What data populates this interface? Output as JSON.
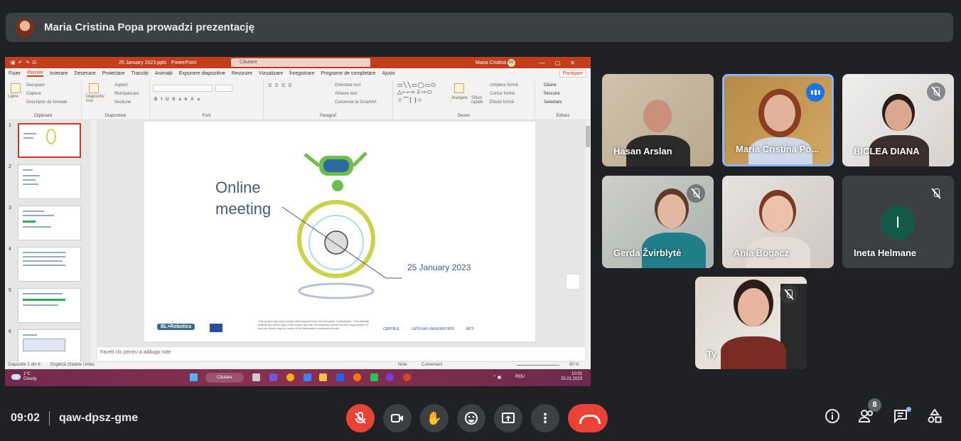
{
  "banner": {
    "presenter_text": "Maria Cristina Popa prowadzi prezentację"
  },
  "ppt": {
    "file_name": "25 January 2023.pptx  ·  PowerPoint",
    "search_placeholder": "Căutare",
    "user_name": "Maria Cristina",
    "user_initials": "MC",
    "share_label": "Partajare",
    "menu": [
      "Fișier",
      "Pornire",
      "Inserare",
      "Desenare",
      "Proiectare",
      "Tranziții",
      "Animații",
      "Expunere diapozitive",
      "Revizuire",
      "Vizualizare",
      "Înregistrare",
      "Programe de completare",
      "Ajutor"
    ],
    "ribbon": {
      "clipboard": {
        "paste": "Lipire",
        "cut": "Decupare",
        "copy": "Copiere",
        "painter": "Descriptor de formate",
        "label": "Clipboard"
      },
      "slides": {
        "new": "Diapozitiv nou",
        "layout": "Aspect",
        "reset": "Reinițializare",
        "section": "Secțiune",
        "label": "Diapozitive"
      },
      "font": {
        "label": "Font"
      },
      "paragraph": {
        "direction": "Orientare text",
        "align": "Aliniere text",
        "smartart": "Conversie la SmartArt",
        "label": "Paragraf"
      },
      "drawing": {
        "arrange": "Aranjare",
        "styles": "Stiluri rapide",
        "fill": "Umplere formă",
        "outline": "Contur formă",
        "effects": "Efecte formă",
        "label": "Desen"
      },
      "editing": {
        "find": "Găsire",
        "replace": "Înlocuire",
        "select": "Selectare",
        "label": "Editare"
      }
    },
    "slide_numbers": [
      "1",
      "2",
      "3",
      "4",
      "5",
      "6"
    ],
    "slide": {
      "title": "Online meeting",
      "date": "25 January 2023",
      "robotics_label": "BL+Robotics",
      "funded_text": "Funded by the Erasmus+ Programme of the European Union",
      "disclaimer": "This project has been funded with support from the European Commission. This website reflects the views only of the author and the Commission cannot be held responsible for any use which may be made of the information contained therein.",
      "logos": [
        "CENTRUL",
        "",
        "",
        "LATVIJAS UNIVERSITĀTE",
        "BETi"
      ]
    },
    "notes_placeholder": "Faceți clic pentru a adăuga note",
    "status": {
      "slide": "Diapozitiv 1 din 6",
      "language": "Engleză (Statele Unite)",
      "notes": "Note",
      "comments": "Comentarii",
      "zoom": "80 %"
    },
    "taskbar": {
      "temp": "1°C",
      "weather": "Cloudy",
      "search": "Căutare",
      "lang": "ROU",
      "time": "10:02",
      "date": "25.01.2023"
    }
  },
  "participants": [
    {
      "name": "Hasan Arslan",
      "muted": false
    },
    {
      "name": "Maria Cristina Po...",
      "muted": false,
      "speaking": true
    },
    {
      "name": "BICLEA DIANA",
      "muted": true
    },
    {
      "name": "Gerda Žvirblytė",
      "muted": true
    },
    {
      "name": "Ania Bogacz",
      "muted": false
    },
    {
      "name": "Ineta Helmane",
      "muted": true,
      "initial": "I"
    },
    {
      "name": "Ty",
      "muted": true
    }
  ],
  "bottom": {
    "time": "09:02",
    "meeting_code": "qaw-dpsz-gme",
    "participants_count": "8"
  },
  "colors": {
    "accent_red": "#ea4335",
    "ppt_orange": "#c43e1c",
    "speaking_blue": "#1a73e8"
  }
}
